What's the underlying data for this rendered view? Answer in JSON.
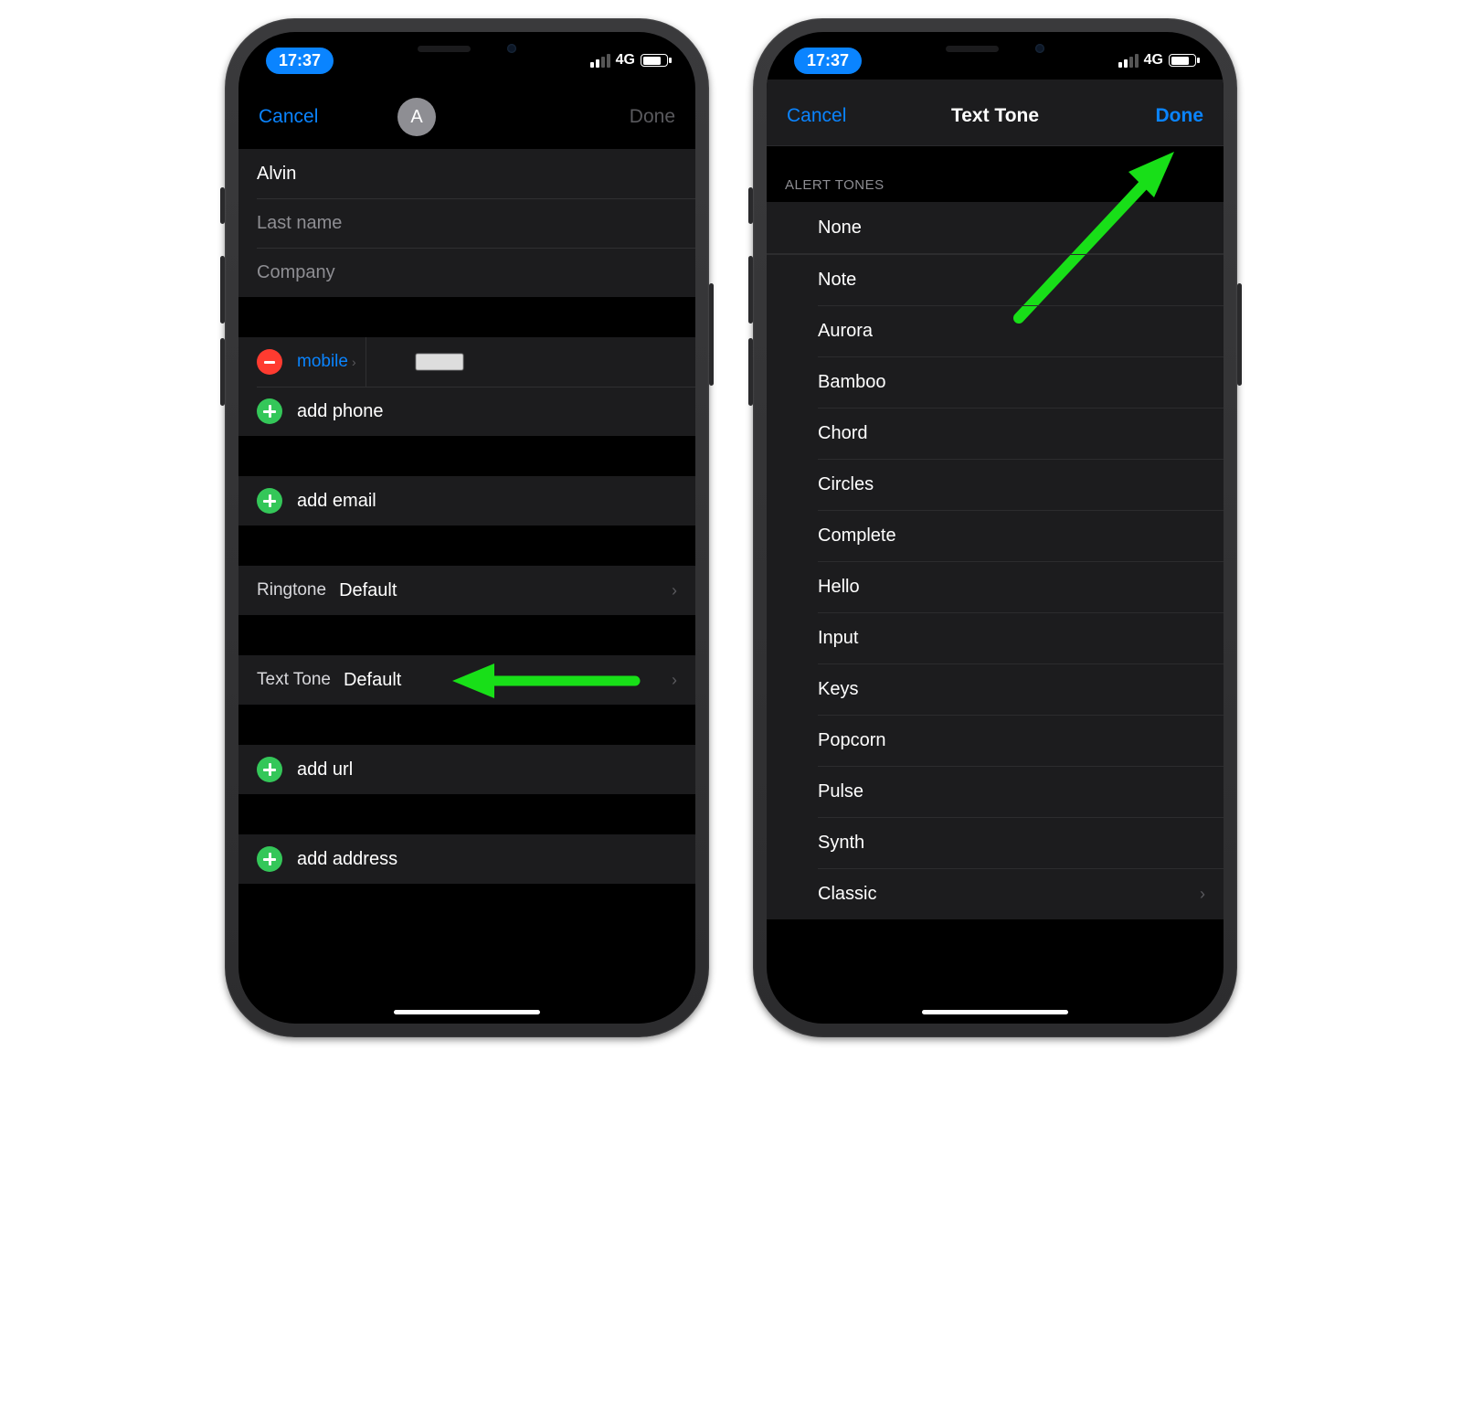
{
  "status": {
    "time": "17:37",
    "network": "4G"
  },
  "left": {
    "nav": {
      "cancel": "Cancel",
      "done": "Done",
      "avatar_initial": "A"
    },
    "fields": {
      "first_name": "Alvin",
      "last_name_placeholder": "Last name",
      "company_placeholder": "Company"
    },
    "phone": {
      "label": "mobile",
      "add": "add phone"
    },
    "email": {
      "add": "add email"
    },
    "ringtone": {
      "label": "Ringtone",
      "value": "Default"
    },
    "texttone": {
      "label": "Text Tone",
      "value": "Default"
    },
    "url": {
      "add": "add url"
    },
    "address": {
      "add": "add address"
    }
  },
  "right": {
    "nav": {
      "cancel": "Cancel",
      "title": "Text Tone",
      "done": "Done"
    },
    "section": "ALERT TONES",
    "tones": [
      "None",
      "Note",
      "Aurora",
      "Bamboo",
      "Chord",
      "Circles",
      "Complete",
      "Hello",
      "Input",
      "Keys",
      "Popcorn",
      "Pulse",
      "Synth",
      "Classic"
    ]
  }
}
